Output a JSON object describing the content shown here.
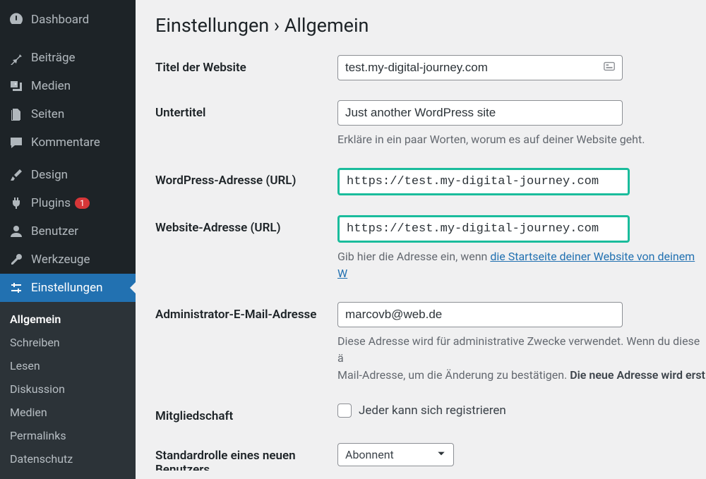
{
  "sidebar": {
    "items": [
      {
        "label": "Dashboard",
        "icon": "dashboard"
      },
      {
        "label": "Beiträge",
        "icon": "pin"
      },
      {
        "label": "Medien",
        "icon": "media"
      },
      {
        "label": "Seiten",
        "icon": "pages"
      },
      {
        "label": "Kommentare",
        "icon": "comments"
      },
      {
        "label": "Design",
        "icon": "brush"
      },
      {
        "label": "Plugins",
        "icon": "plug",
        "badge": "1"
      },
      {
        "label": "Benutzer",
        "icon": "user"
      },
      {
        "label": "Werkzeuge",
        "icon": "wrench"
      },
      {
        "label": "Einstellungen",
        "icon": "sliders"
      }
    ],
    "submenu": [
      "Allgemein",
      "Schreiben",
      "Lesen",
      "Diskussion",
      "Medien",
      "Permalinks",
      "Datenschutz"
    ]
  },
  "page": {
    "title": "Einstellungen › Allgemein",
    "fields": {
      "site_title_label": "Titel der Website",
      "site_title_value": "test.my-digital-journey.com",
      "tagline_label": "Untertitel",
      "tagline_value": "Just another WordPress site",
      "tagline_desc": "Erkläre in ein paar Worten, worum es auf deiner Website geht.",
      "wpurl_label": "WordPress-Adresse (URL)",
      "wpurl_value": "https://test.my-digital-journey.com",
      "siteurl_label": "Website-Adresse (URL)",
      "siteurl_value": "https://test.my-digital-journey.com",
      "siteurl_desc_a": "Gib hier die Adresse ein, wenn ",
      "siteurl_desc_link": "die Startseite deiner Website von deinem W",
      "admin_email_label": "Administrator-E-Mail-Adresse",
      "admin_email_value": "marcovb@web.de",
      "admin_email_desc_a": "Diese Adresse wird für administrative Zwecke verwendet. Wenn du diese ä",
      "admin_email_desc_b": "Mail-Adresse, um die Änderung zu bestätigen. ",
      "admin_email_desc_bold": "Die neue Adresse wird erst",
      "membership_label": "Mitgliedschaft",
      "membership_option": "Jeder kann sich registrieren",
      "default_role_label": "Standardrolle eines neuen Benutzers",
      "default_role_value": "Abonnent"
    }
  }
}
